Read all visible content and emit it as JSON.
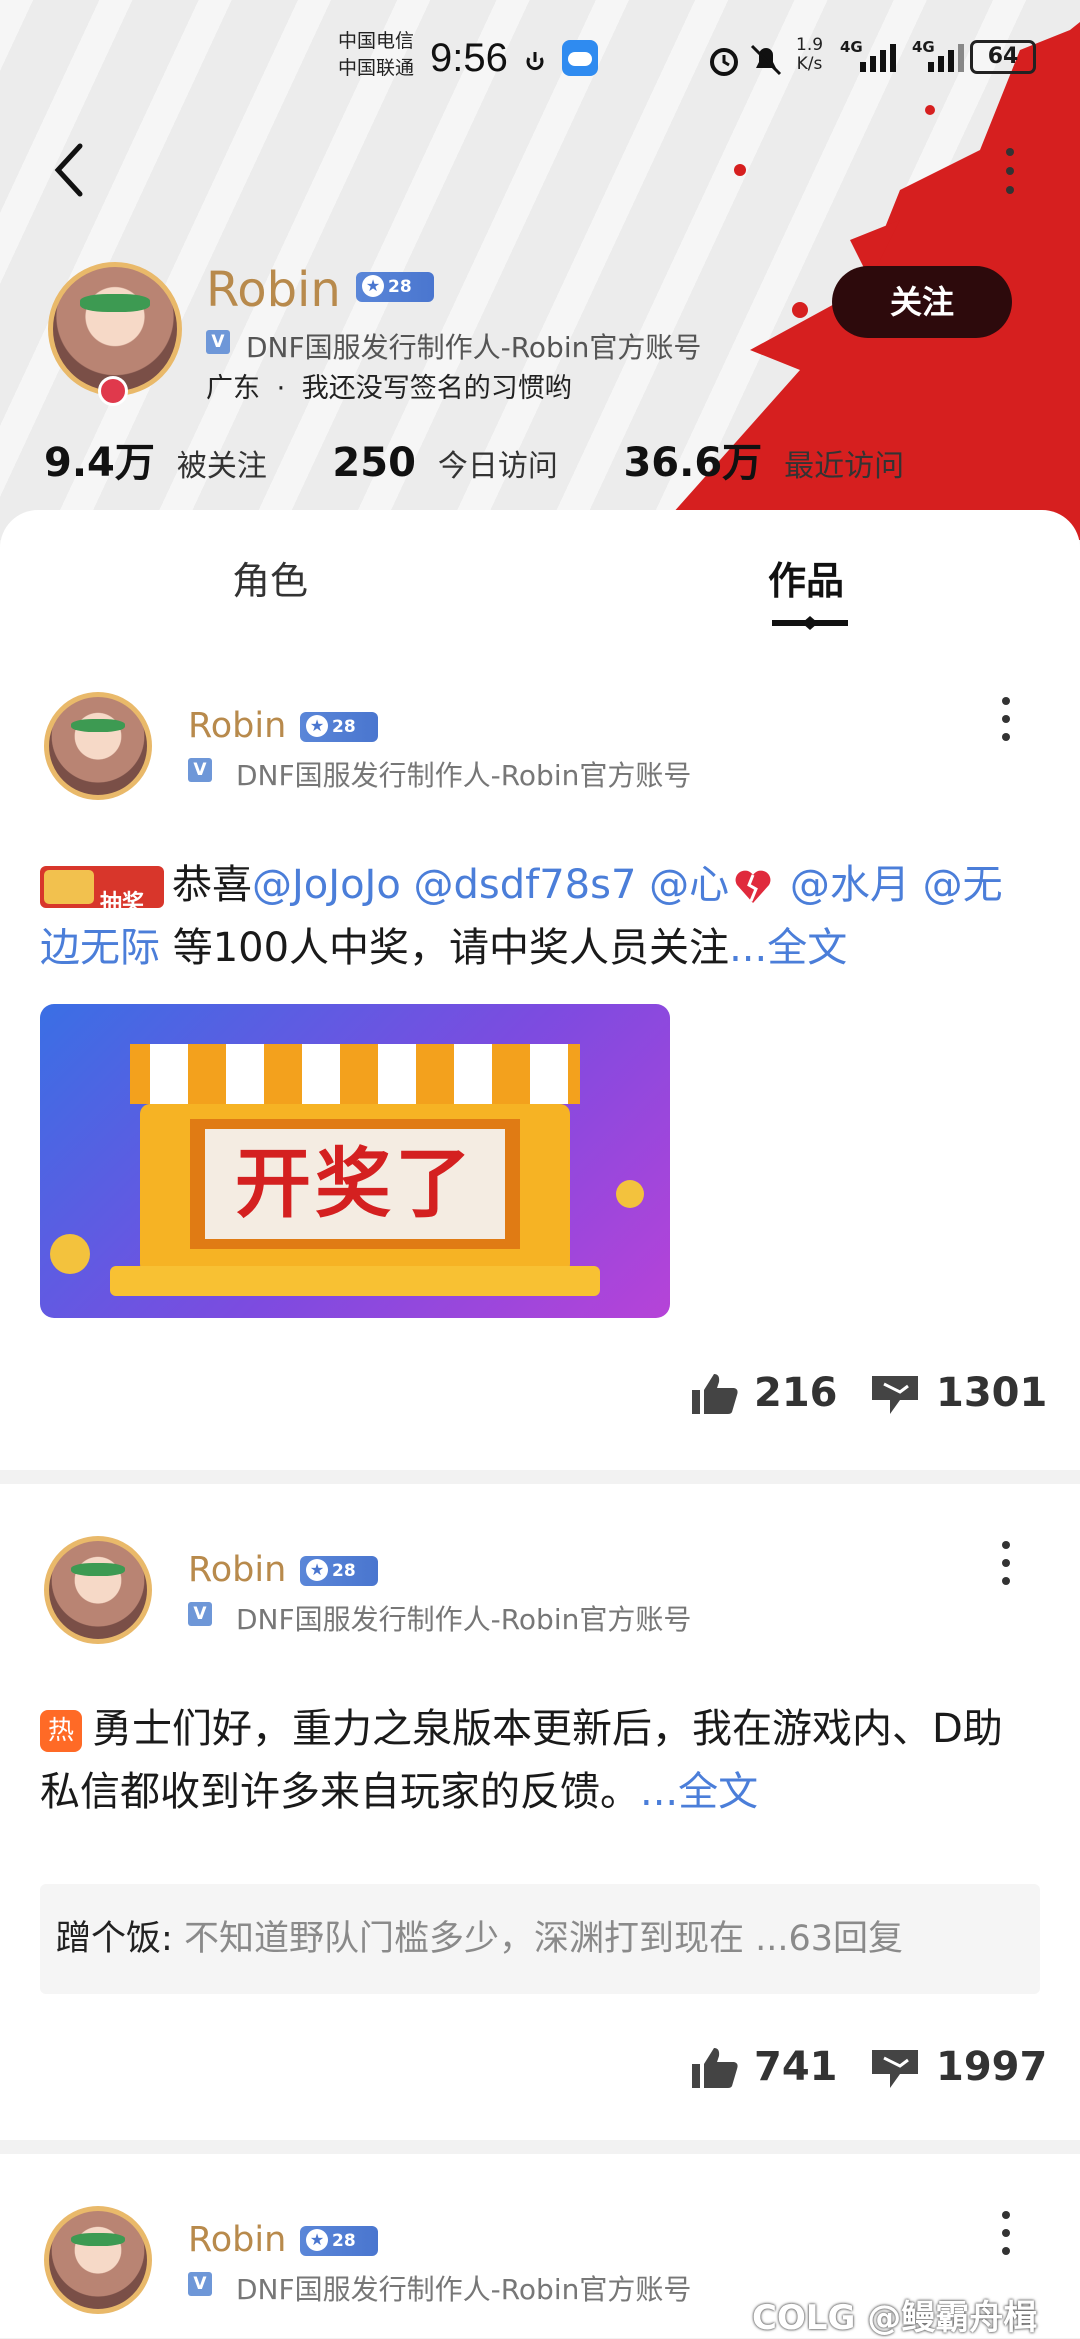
{
  "status_bar": {
    "carrier_1": "中国电信",
    "carrier_2": "中国联通",
    "time": "9:56",
    "net_speed_value": "1.9",
    "net_speed_unit": "K/s",
    "signal_1_label": "4G",
    "signal_2_label": "4G",
    "battery": "64"
  },
  "profile": {
    "name": "Robin",
    "level": "28",
    "verified_label": "DNF国服发行制作人-Robin官方账号",
    "location": "广东",
    "separator": "·",
    "bio": "我还没写签名的习惯哟",
    "follow_button": "关注",
    "stats": [
      {
        "value": "9.4万",
        "label": "被关注"
      },
      {
        "value": "250",
        "label": "今日访问"
      },
      {
        "value": "36.6万",
        "label": "最近访问"
      }
    ]
  },
  "tabs": [
    {
      "label": "角色",
      "active": false
    },
    {
      "label": "作品",
      "active": true
    }
  ],
  "posts": [
    {
      "author": "Robin",
      "level": "28",
      "verified_label": "DNF国服发行制作人-Robin官方账号",
      "tag": "抽奖",
      "text_prefix": "恭喜",
      "mentions": [
        "@JoJoJo",
        "@dsdf78s7",
        "@心",
        "@水月",
        "@无边无际"
      ],
      "text_suffix": " 等100人中奖，请中奖人员关注",
      "more_link": "...全文",
      "image_text": "开奖了",
      "likes": "216",
      "comments": "1301"
    },
    {
      "author": "Robin",
      "level": "28",
      "verified_label": "DNF国服发行制作人-Robin官方账号",
      "tag": "热",
      "text": "勇士们好，重力之泉版本更新后，我在游戏内、D助私信都收到许多来自玩家的反馈。",
      "more_link": "...全文",
      "comment_author": "蹭个饭",
      "comment_sep": ": ",
      "comment_text": "不知道野队门槛多少，深渊打到现在 ...63回复",
      "likes": "741",
      "comments": "1997"
    },
    {
      "author": "Robin",
      "level": "28",
      "verified_label": "DNF国服发行制作人-Robin官方账号"
    }
  ],
  "watermark": "COLG @鳗霸舟楫",
  "colors": {
    "accent_blue": "#4b7ed9",
    "name_gold": "#b88a4c",
    "follow_bg": "#2d0a0c",
    "splash_red": "#d61f1f"
  }
}
